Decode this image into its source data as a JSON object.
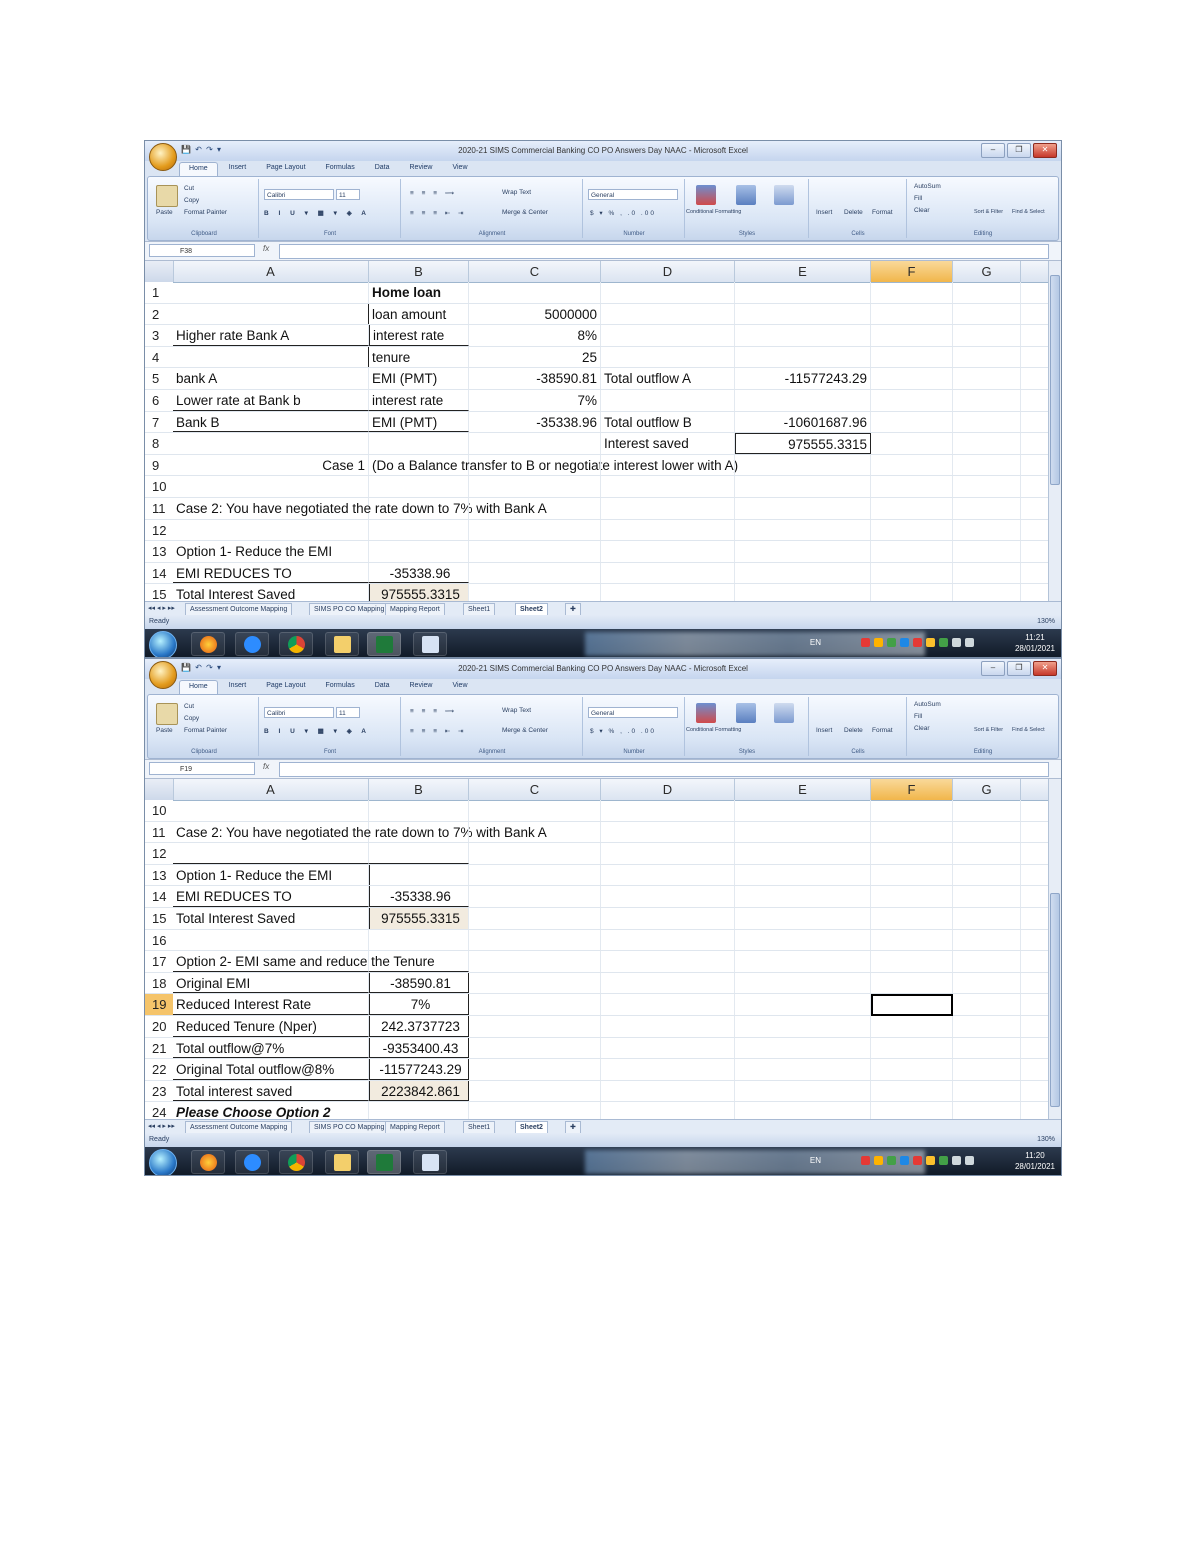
{
  "window": {
    "title1": "2020-21 SIMS Commercial Banking CO PO Answers Day NAAC - Microsoft Excel",
    "title2": "2020-21 SIMS Commercial Banking CO PO Answers Day NAAC - Microsoft Excel"
  },
  "ribbon": {
    "tabs": [
      "Home",
      "Insert",
      "Page Layout",
      "Formulas",
      "Data",
      "Review",
      "View"
    ],
    "clipboard": {
      "cut": "Cut",
      "copy": "Copy",
      "paste": "Paste",
      "format_painter": "Format Painter",
      "label": "Clipboard"
    },
    "font": {
      "name": "Calibri",
      "size": "11",
      "label": "Font"
    },
    "alignment": {
      "wrap": "Wrap Text",
      "merge": "Merge & Center",
      "label": "Alignment"
    },
    "number": {
      "format": "General",
      "label": "Number"
    },
    "styles": {
      "conditional": "Conditional Formatting",
      "format_table": "Format as Table",
      "cell_styles": "Cell Styles",
      "label": "Styles"
    },
    "cells": {
      "insert": "Insert",
      "delete": "Delete",
      "format": "Format",
      "label": "Cells"
    },
    "editing": {
      "autosum": "AutoSum",
      "fill": "Fill",
      "clear": "Clear",
      "sort": "Sort & Filter",
      "find": "Find & Select",
      "label": "Editing"
    }
  },
  "namebox1": "F38",
  "namebox2": "F19",
  "columns": [
    "A",
    "B",
    "C",
    "D",
    "E",
    "F",
    "G"
  ],
  "sheet1": {
    "rows": [
      {
        "n": "1",
        "B": "Home loan"
      },
      {
        "n": "2",
        "B": "loan amount",
        "C": "5000000"
      },
      {
        "n": "3",
        "A": "Higher rate Bank A",
        "B": "interest rate",
        "C": "8%"
      },
      {
        "n": "4",
        "B": "tenure",
        "C": "25"
      },
      {
        "n": "5",
        "A": "bank A",
        "B": "EMI (PMT)",
        "C": "-38590.81",
        "D": "Total outflow A",
        "E": "-11577243.29"
      },
      {
        "n": "6",
        "A": "Lower rate at Bank b",
        "B": "interest rate",
        "C": "7%"
      },
      {
        "n": "7",
        "A": "Bank B",
        "B": "EMI (PMT)",
        "C": "-35338.96",
        "D": "Total outflow B",
        "E": "-10601687.96"
      },
      {
        "n": "8",
        "D": "Interest saved",
        "E": "975555.3315"
      },
      {
        "n": "9",
        "A": "Case 1",
        "B": "(Do a Balance transfer to B or negotiate interest lower with A)"
      },
      {
        "n": "10"
      },
      {
        "n": "11",
        "A": "Case 2: You have negotiated the rate down to 7% with Bank A"
      },
      {
        "n": "12"
      },
      {
        "n": "13",
        "A": "Option 1- Reduce the EMI"
      },
      {
        "n": "14",
        "A": "EMI REDUCES TO",
        "B": "-35338.96"
      },
      {
        "n": "15",
        "A": "Total Interest Saved",
        "B": "975555.3315"
      }
    ]
  },
  "sheet2": {
    "rows": [
      {
        "n": "10"
      },
      {
        "n": "11",
        "A": "Case 2: You have negotiated the rate down to 7% with Bank A"
      },
      {
        "n": "12"
      },
      {
        "n": "13",
        "A": "Option 1- Reduce the EMI"
      },
      {
        "n": "14",
        "A": "EMI REDUCES TO",
        "B": "-35338.96"
      },
      {
        "n": "15",
        "A": "Total Interest Saved",
        "B": "975555.3315"
      },
      {
        "n": "16"
      },
      {
        "n": "17",
        "A": "Option 2- EMI same and reduce the Tenure"
      },
      {
        "n": "18",
        "A": "Original EMI",
        "B": "-38590.81"
      },
      {
        "n": "19",
        "A": "Reduced Interest Rate",
        "B": "7%"
      },
      {
        "n": "20",
        "A": "Reduced Tenure (Nper)",
        "B": "242.3737723"
      },
      {
        "n": "21",
        "A": "Total outflow@7%",
        "B": "-9353400.43"
      },
      {
        "n": "22",
        "A": "Original Total outflow@8%",
        "B": "-11577243.29"
      },
      {
        "n": "23",
        "A": "Total interest saved",
        "B": "2223842.861"
      },
      {
        "n": "24",
        "A": "Please Choose Option 2"
      }
    ]
  },
  "sheet_tabs": [
    "Assessment Outcome Mapping",
    "SIMS PO CO Mapping",
    "Mapping Report",
    "Sheet1",
    "Sheet2"
  ],
  "status": {
    "ready": "Ready",
    "zoom": "130%"
  },
  "taskbar": {
    "lang": "EN",
    "time1": "11:21",
    "date1": "28/01/2021",
    "time2": "11:20",
    "date2": "28/01/2021"
  }
}
